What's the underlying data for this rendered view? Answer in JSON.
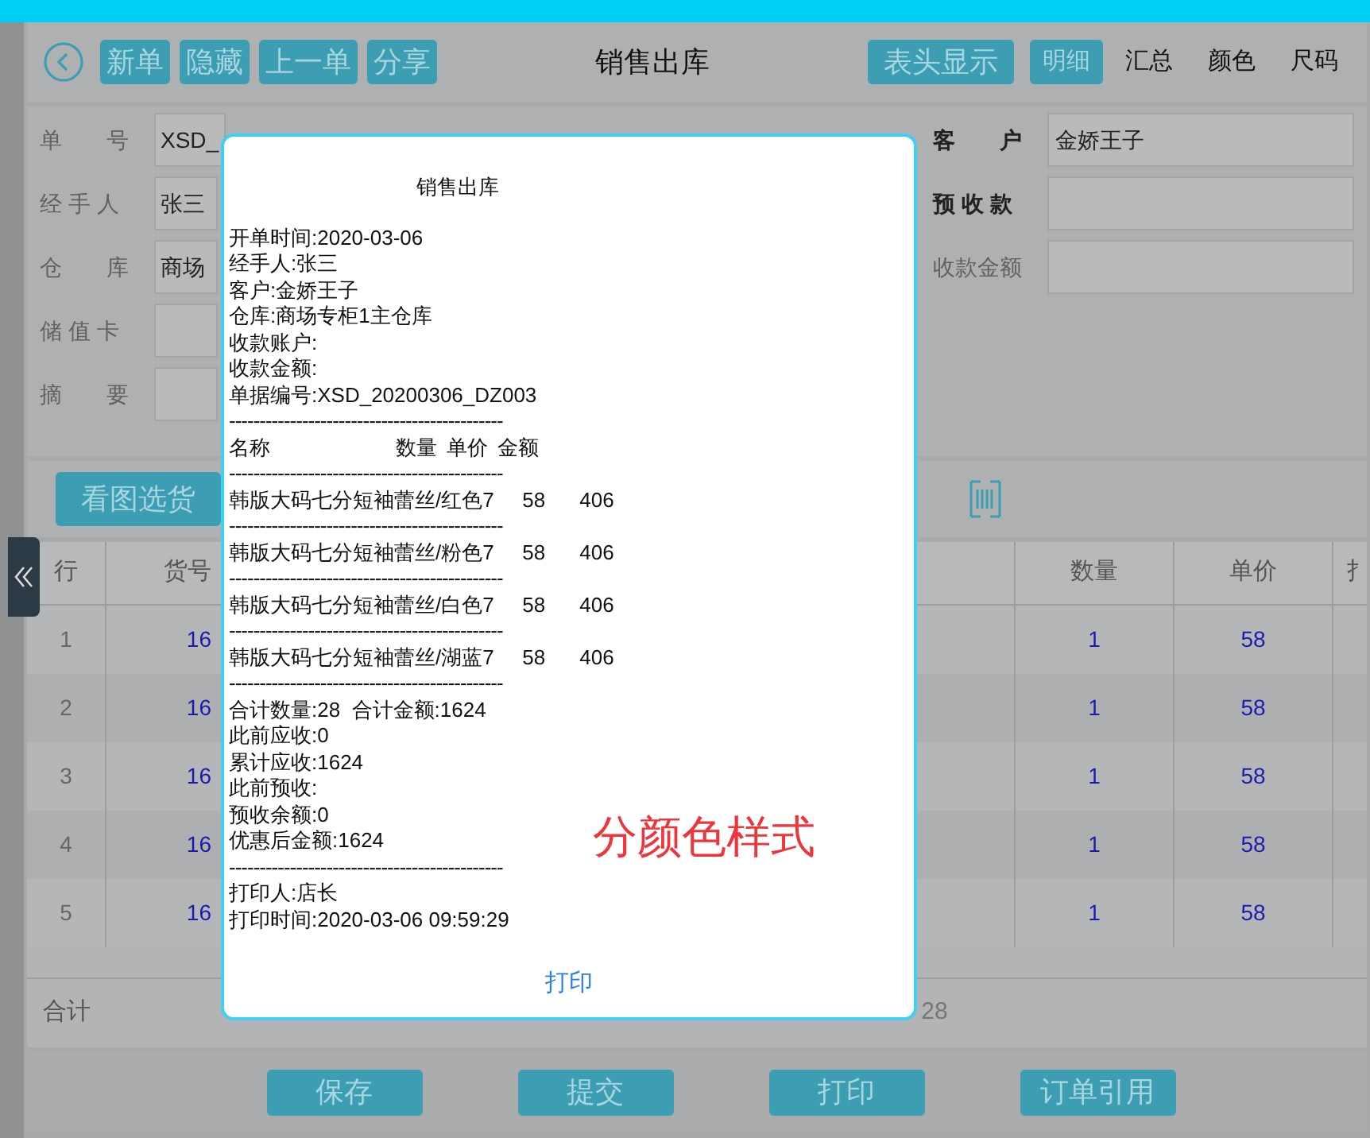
{
  "toolbar": {
    "left_buttons": [
      "新单",
      "隐藏",
      "上一单",
      "分享"
    ],
    "title": "销售出库",
    "header_toggle": "表头显示",
    "view_tabs": [
      {
        "label": "明细",
        "selected": true
      },
      {
        "label": "汇总",
        "selected": false
      },
      {
        "label": "颜色",
        "selected": false
      },
      {
        "label": "尺码",
        "selected": false
      }
    ]
  },
  "form": {
    "left_fields": [
      {
        "label": "单　　号",
        "value": "XSD_"
      },
      {
        "label": "经 手 人",
        "value": "张三"
      },
      {
        "label": "仓　　库",
        "value": "商场"
      },
      {
        "label": "储 值 卡"
      },
      {
        "label": "摘　　要"
      }
    ],
    "right_fields": [
      {
        "label": "客　　户",
        "value": "金娇王子",
        "bold": true
      },
      {
        "label": "预 收 款",
        "bold": true
      },
      {
        "label": "收款金额",
        "bold": false
      }
    ]
  },
  "pick_button": "看图选货",
  "table": {
    "columns": [
      "行",
      "货号",
      "数量",
      "单价",
      "扌"
    ],
    "rows": [
      {
        "row": "1",
        "code": "16",
        "qty": "1",
        "price": "58"
      },
      {
        "row": "2",
        "code": "16",
        "qty": "1",
        "price": "58"
      },
      {
        "row": "3",
        "code": "16",
        "qty": "1",
        "price": "58"
      },
      {
        "row": "4",
        "code": "16",
        "qty": "1",
        "price": "58"
      },
      {
        "row": "5",
        "code": "16",
        "qty": "1",
        "price": "58"
      }
    ],
    "total_label": "合计",
    "total_qty": "28"
  },
  "footer_buttons": [
    "保存",
    "提交",
    "打印",
    "订单引用"
  ],
  "dialog": {
    "title": "销售出库",
    "lines": [
      {
        "kind": "text",
        "text": "开单时间:2020-03-06"
      },
      {
        "kind": "text",
        "text": "经手人:张三"
      },
      {
        "kind": "text",
        "text": "客户:金娇王子"
      },
      {
        "kind": "text",
        "text": "仓库:商场专柜1主仓库"
      },
      {
        "kind": "text",
        "text": "收款账户:"
      },
      {
        "kind": "text",
        "text": "收款金额:"
      },
      {
        "kind": "text",
        "text": "单据编号:XSD_20200306_DZ003"
      },
      {
        "kind": "rule",
        "text": "---------------------------------------------"
      },
      {
        "kind": "head",
        "cols": [
          "名称",
          "数量",
          "单价",
          "金额"
        ]
      },
      {
        "kind": "rule",
        "text": "---------------------------------------------"
      },
      {
        "kind": "item",
        "cols": [
          "韩版大码七分短袖蕾丝/红色",
          "7",
          "58",
          "406"
        ]
      },
      {
        "kind": "rule",
        "text": "---------------------------------------------"
      },
      {
        "kind": "item",
        "cols": [
          "韩版大码七分短袖蕾丝/粉色",
          "7",
          "58",
          "406"
        ]
      },
      {
        "kind": "rule",
        "text": "---------------------------------------------"
      },
      {
        "kind": "item",
        "cols": [
          "韩版大码七分短袖蕾丝/白色",
          "7",
          "58",
          "406"
        ]
      },
      {
        "kind": "rule",
        "text": "---------------------------------------------"
      },
      {
        "kind": "item",
        "cols": [
          "韩版大码七分短袖蕾丝/湖蓝",
          "7",
          "58",
          "406"
        ]
      },
      {
        "kind": "rule",
        "text": "---------------------------------------------"
      },
      {
        "kind": "text",
        "text": "合计数量:28  合计金额:1624"
      },
      {
        "kind": "text",
        "text": "此前应收:0"
      },
      {
        "kind": "text",
        "text": "累计应收:1624"
      },
      {
        "kind": "text",
        "text": "此前预收:"
      },
      {
        "kind": "text",
        "text": "预收余额:0"
      },
      {
        "kind": "text",
        "text": "优惠后金额:1624"
      },
      {
        "kind": "rule",
        "text": "---------------------------------------------"
      },
      {
        "kind": "text",
        "text": "打印人:店长"
      },
      {
        "kind": "text",
        "text": "打印时间:2020-03-06 09:59:29"
      }
    ],
    "print_button": "打印",
    "annotation": "分颜色样式"
  }
}
